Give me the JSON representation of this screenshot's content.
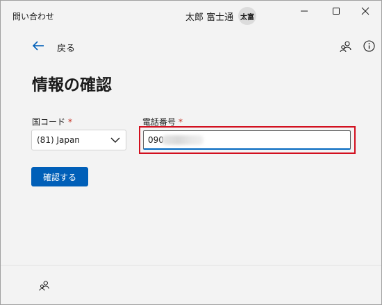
{
  "titlebar": {
    "app_title": "問い合わせ",
    "user_name": "太郎 富士通",
    "avatar_initials": "太富",
    "minimize_icon": "minimize-icon",
    "maximize_icon": "maximize-icon",
    "close_icon": "close-icon"
  },
  "nav": {
    "back_label": "戻る",
    "back_icon": "arrow-left-icon",
    "people_icon": "people-icon",
    "info_icon": "info-icon"
  },
  "page": {
    "title": "情報の確認"
  },
  "form": {
    "country_label": "国コード",
    "phone_label": "電話番号",
    "required_mark": "*",
    "country_value": "(81) Japan",
    "phone_value": "090"
  },
  "actions": {
    "confirm_label": "確認する"
  },
  "colors": {
    "accent": "#005fb8",
    "required": "#c42b1c",
    "highlight": "#d20f1e"
  }
}
